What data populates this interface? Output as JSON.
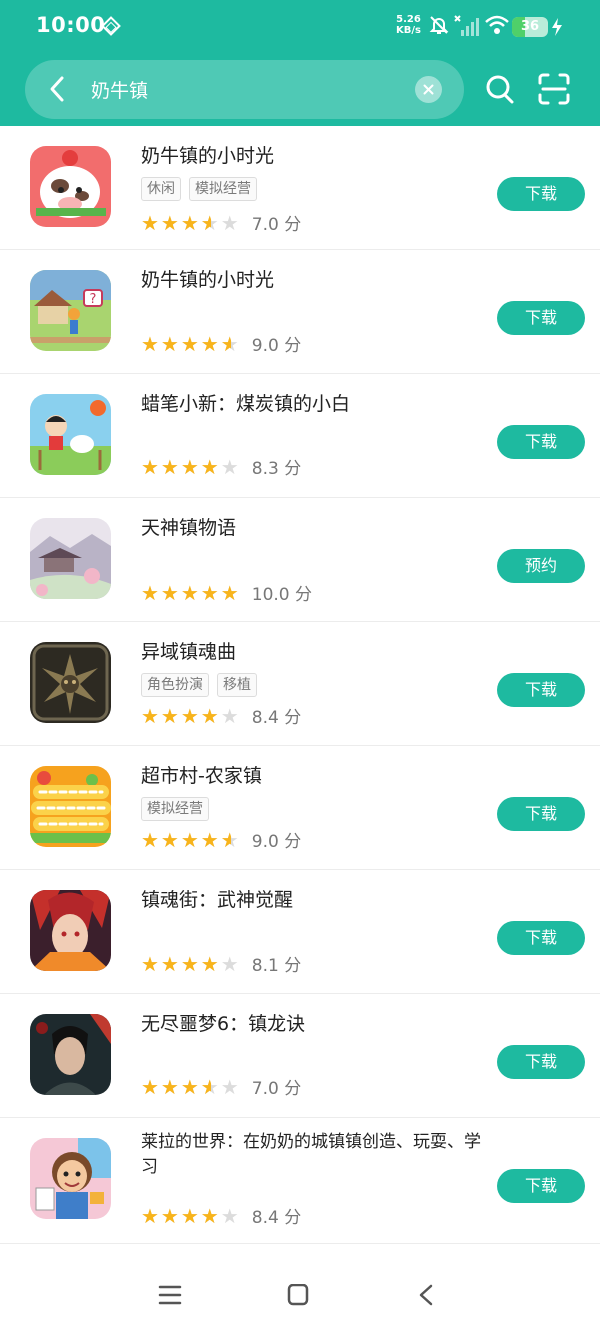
{
  "status": {
    "time": "10:00",
    "net_speed": "5.26",
    "net_unit": "KB/s",
    "battery": "36"
  },
  "search": {
    "value": "奶牛镇",
    "placeholder": ""
  },
  "apps": [
    {
      "name": "奶牛镇的小时光",
      "tags": [
        "休闲",
        "模拟经营"
      ],
      "rating": 3.5,
      "score": "7.0 分",
      "button": "下载",
      "icon": "cow-cartoon-icon"
    },
    {
      "name": "奶牛镇的小时光",
      "tags": [],
      "rating": 4.5,
      "score": "9.0 分",
      "button": "下载",
      "icon": "farm-village-icon"
    },
    {
      "name": "蜡笔小新：煤炭镇的小白",
      "tags": [],
      "rating": 4,
      "score": "8.3 分",
      "button": "下载",
      "icon": "crayon-shinchan-icon"
    },
    {
      "name": "天神镇物语",
      "tags": [],
      "rating": 5,
      "score": "10.0 分",
      "button": "预约",
      "icon": "shrine-town-icon"
    },
    {
      "name": "异域镇魂曲",
      "tags": [
        "角色扮演",
        "移植"
      ],
      "rating": 4,
      "score": "8.4 分",
      "button": "下载",
      "icon": "torment-face-icon"
    },
    {
      "name": "超市村-农家镇",
      "tags": [
        "模拟经营"
      ],
      "rating": 4.5,
      "score": "9.0 分",
      "button": "下载",
      "icon": "supermarket-village-icon"
    },
    {
      "name": "镇魂街：武神觉醒",
      "tags": [],
      "rating": 4,
      "score": "8.1 分",
      "button": "下载",
      "icon": "anime-warrior-icon"
    },
    {
      "name": "无尽噩梦6：镇龙诀",
      "tags": [],
      "rating": 3.5,
      "score": "7.0 分",
      "button": "下载",
      "icon": "dark-warrior-icon"
    },
    {
      "name": "莱拉的世界：在奶奶的城镇镇创造、玩耍、学习",
      "tags": [],
      "rating": 4,
      "score": "8.4 分",
      "button": "下载",
      "icon": "leila-cartoon-icon"
    }
  ],
  "colors": {
    "accent": "#1ebaa0",
    "star": "#f8b41b"
  }
}
